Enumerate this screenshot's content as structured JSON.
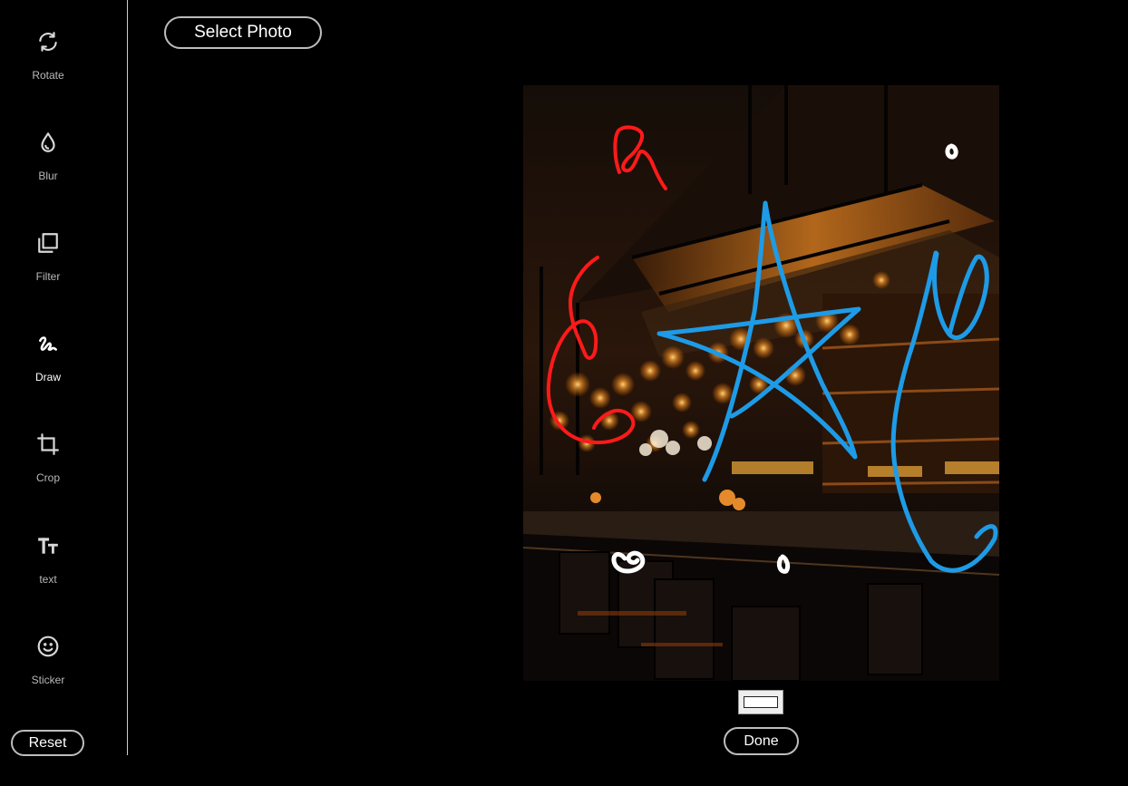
{
  "sidebar": {
    "tools": [
      {
        "label": "Rotate",
        "icon": "rotate-icon"
      },
      {
        "label": "Blur",
        "icon": "drop-icon"
      },
      {
        "label": "Filter",
        "icon": "filter-icon"
      },
      {
        "label": "Draw",
        "icon": "draw-icon",
        "active": true
      },
      {
        "label": "Crop",
        "icon": "crop-icon"
      },
      {
        "label": "text",
        "icon": "text-icon"
      },
      {
        "label": "Sticker",
        "icon": "smiley-icon"
      }
    ],
    "reset_label": "Reset"
  },
  "toolbar": {
    "select_photo_label": "Select Photo"
  },
  "editor": {
    "done_label": "Done",
    "pen_color": "#ffffff",
    "stroke_colors": [
      "#ff1a1a",
      "#1e9be6",
      "#ffffff"
    ]
  }
}
